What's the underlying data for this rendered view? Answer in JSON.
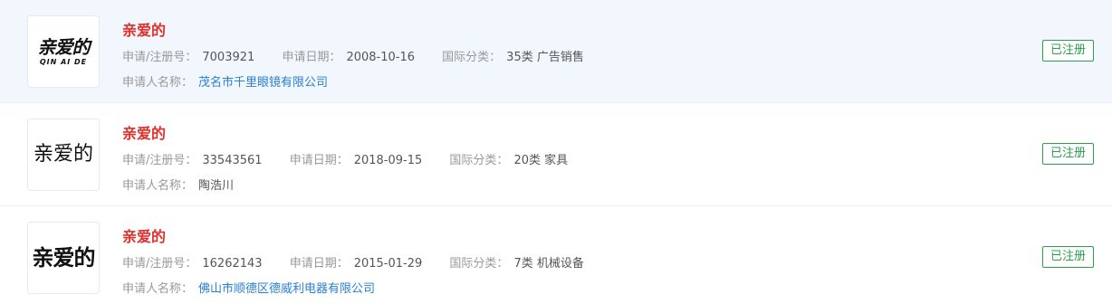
{
  "labels": {
    "reg_no": "申请/注册号：",
    "apply_date": "申请日期：",
    "intl_class": "国际分类：",
    "applicant": "申请人名称："
  },
  "trademarks": [
    {
      "logo_text": "亲爱的",
      "logo_subtext": "QIN AI DE",
      "name": "亲爱的",
      "reg_no": "7003921",
      "apply_date": "2008-10-16",
      "intl_class": "35类 广告销售",
      "applicant": "茂名市千里眼镜有限公司",
      "status": "已注册"
    },
    {
      "logo_text": "亲爱的",
      "name": "亲爱的",
      "reg_no": "33543561",
      "apply_date": "2018-09-15",
      "intl_class": "20类 家具",
      "applicant": "陶浩川",
      "status": "已注册"
    },
    {
      "logo_text": "亲爱的",
      "name": "亲爱的",
      "reg_no": "16262143",
      "apply_date": "2015-01-29",
      "intl_class": "7类 机械设备",
      "applicant": "佛山市顺德区德威利电器有限公司",
      "status": "已注册"
    }
  ],
  "colors": {
    "title": "#e0302c",
    "link": "#2a7fd4",
    "status": "#2e9e4f",
    "hover_row": "#f2f6fd"
  }
}
